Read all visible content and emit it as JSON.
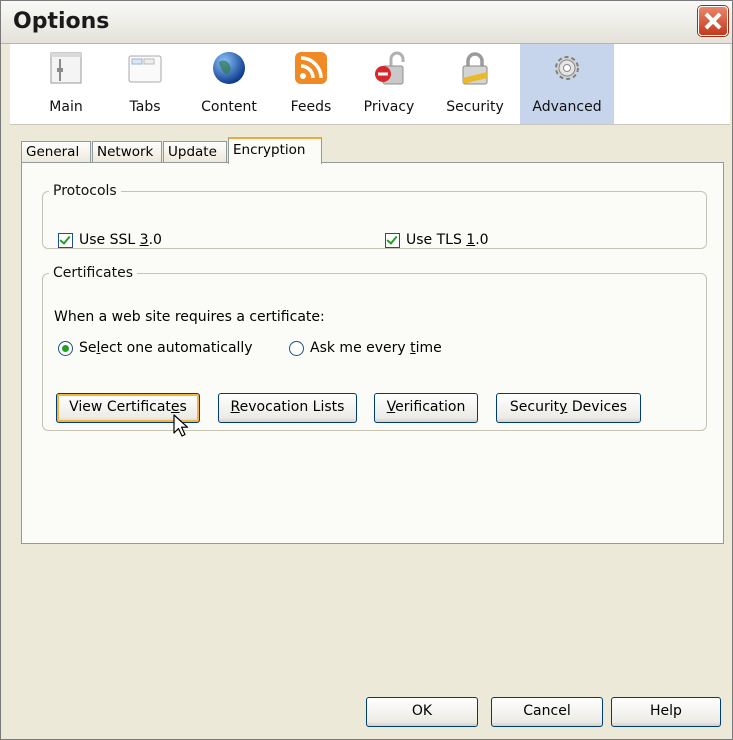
{
  "window": {
    "title": "Options"
  },
  "toolbar": {
    "items": [
      {
        "label": "Main",
        "icon": "main-icon"
      },
      {
        "label": "Tabs",
        "icon": "tabs-icon"
      },
      {
        "label": "Content",
        "icon": "content-globe-icon"
      },
      {
        "label": "Feeds",
        "icon": "feeds-rss-icon"
      },
      {
        "label": "Privacy",
        "icon": "privacy-lock-icon"
      },
      {
        "label": "Security",
        "icon": "security-padlock-icon"
      },
      {
        "label": "Advanced",
        "icon": "advanced-gear-icon",
        "selected": true
      }
    ]
  },
  "tabs": [
    "General",
    "Network",
    "Update",
    "Encryption"
  ],
  "active_tab": "Encryption",
  "protocols": {
    "legend": "Protocols",
    "ssl": {
      "pre": "Use SSL ",
      "acc": "3",
      "post": ".0",
      "checked": true
    },
    "tls": {
      "pre": "Use TLS ",
      "acc": "1",
      "post": ".0",
      "checked": true
    }
  },
  "certificates": {
    "legend": "Certificates",
    "prompt": "When a web site requires a certificate:",
    "auto": {
      "pre": "Se",
      "acc": "l",
      "post": "ect one automatically",
      "selected": true
    },
    "ask": {
      "pre": "Ask me every ",
      "acc": "t",
      "post": "ime",
      "selected": false
    },
    "buttons": {
      "view": {
        "pre": "View Certificat",
        "acc": "e",
        "post": "s"
      },
      "revocation": {
        "pre": "",
        "acc": "R",
        "post": "evocation Lists"
      },
      "verification": {
        "pre": "",
        "acc": "V",
        "post": "erification"
      },
      "devices": {
        "pre": "Securit",
        "acc": "y",
        "post": " Devices"
      }
    }
  },
  "footer": {
    "ok": "OK",
    "cancel": "Cancel",
    "help": "Help"
  },
  "colors": {
    "selected_toolbar": "#c6d4ec",
    "accent_check": "#21a121",
    "focus": "#f8b33c"
  }
}
